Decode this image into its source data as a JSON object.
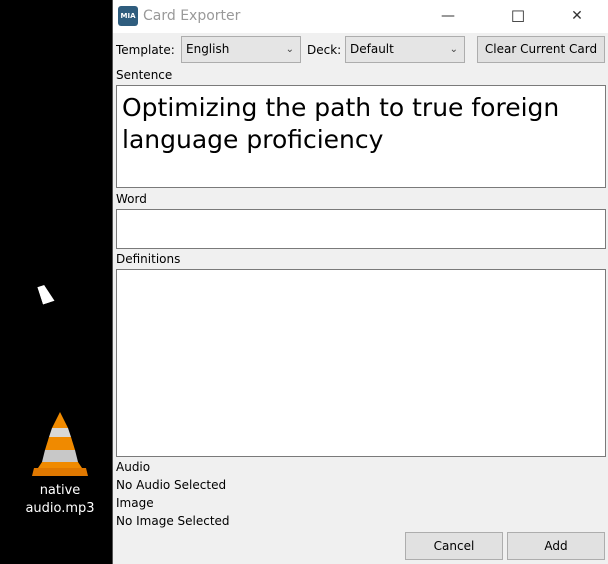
{
  "window": {
    "title": "Card Exporter",
    "logo_text": "MIA",
    "minimize": "—",
    "maximize": "☐",
    "close": "✕"
  },
  "toolbar": {
    "template_label": "Template:",
    "template_value": "English",
    "deck_label": "Deck:",
    "deck_value": "Default",
    "clear_button": "Clear Current Card"
  },
  "fields": {
    "sentence_label": "Sentence",
    "sentence_value": "Optimizing the path to true foreign language proficiency",
    "word_label": "Word",
    "word_value": "",
    "definitions_label": "Definitions",
    "definitions_value": "",
    "audio_label": "Audio",
    "audio_value": "No Audio Selected",
    "image_label": "Image",
    "image_value": "No Image Selected"
  },
  "buttons": {
    "cancel": "Cancel",
    "add": "Add"
  },
  "desktop": {
    "icon_label_line1": "native",
    "icon_label_line2": "audio.mp3"
  }
}
